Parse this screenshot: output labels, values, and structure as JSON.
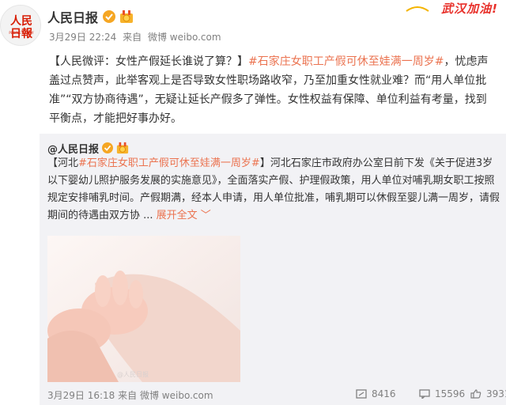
{
  "post": {
    "author": "人民日报",
    "avatar_text": "人民日報",
    "avatar_sub": "PEOPLE'S DAILY",
    "banner_text": "武汉加油!",
    "meta": {
      "date_time": "3月29日 22:24",
      "from_label": "来自",
      "source": "微博 weibo.com"
    },
    "text": {
      "part1": "【人民微评：女性产假延长谁说了算？】",
      "topic": "#石家庄女职工产假可休至娃满一周岁#",
      "part2": "，忧虑声盖过点赞声，此举客观上是否导致女性职场路收窄，乃至加重女性就业难？而“用人单位批准”“双方协商待遇”，无疑让延长产假多了弹性。女性权益有保障、单位利益有考量，找到平衡点，才能把好事办好。"
    }
  },
  "repost": {
    "author": "@人民日报",
    "text": {
      "prefix": "【河北",
      "topic": "#石家庄女职工产假可休至娃满一周岁#",
      "body": "】河北石家庄市政府办公室日前下发《关于促进3岁以下婴幼儿照护服务发展的实施意见》，全面落实产假、护理假政策，用人单位对哺乳期女职工按照规定安排哺乳时间。产假期满，经本人申请，用人单位批准，哺乳期可以休假至婴儿满一周岁，请假期间的待遇由双方协 ...",
      "expand": "展开全文 ﹀"
    },
    "watermark": "@人民日报",
    "meta": {
      "date_time": "3月29日 16:18",
      "from_label": "来自",
      "source": "微博 weibo.com"
    },
    "stats": {
      "reposts": "8416",
      "comments": "15596",
      "likes": "393199"
    }
  },
  "colors": {
    "topic": "#eb7350",
    "brand_red": "#d81e06",
    "repost_bg": "#f2f2f5"
  }
}
